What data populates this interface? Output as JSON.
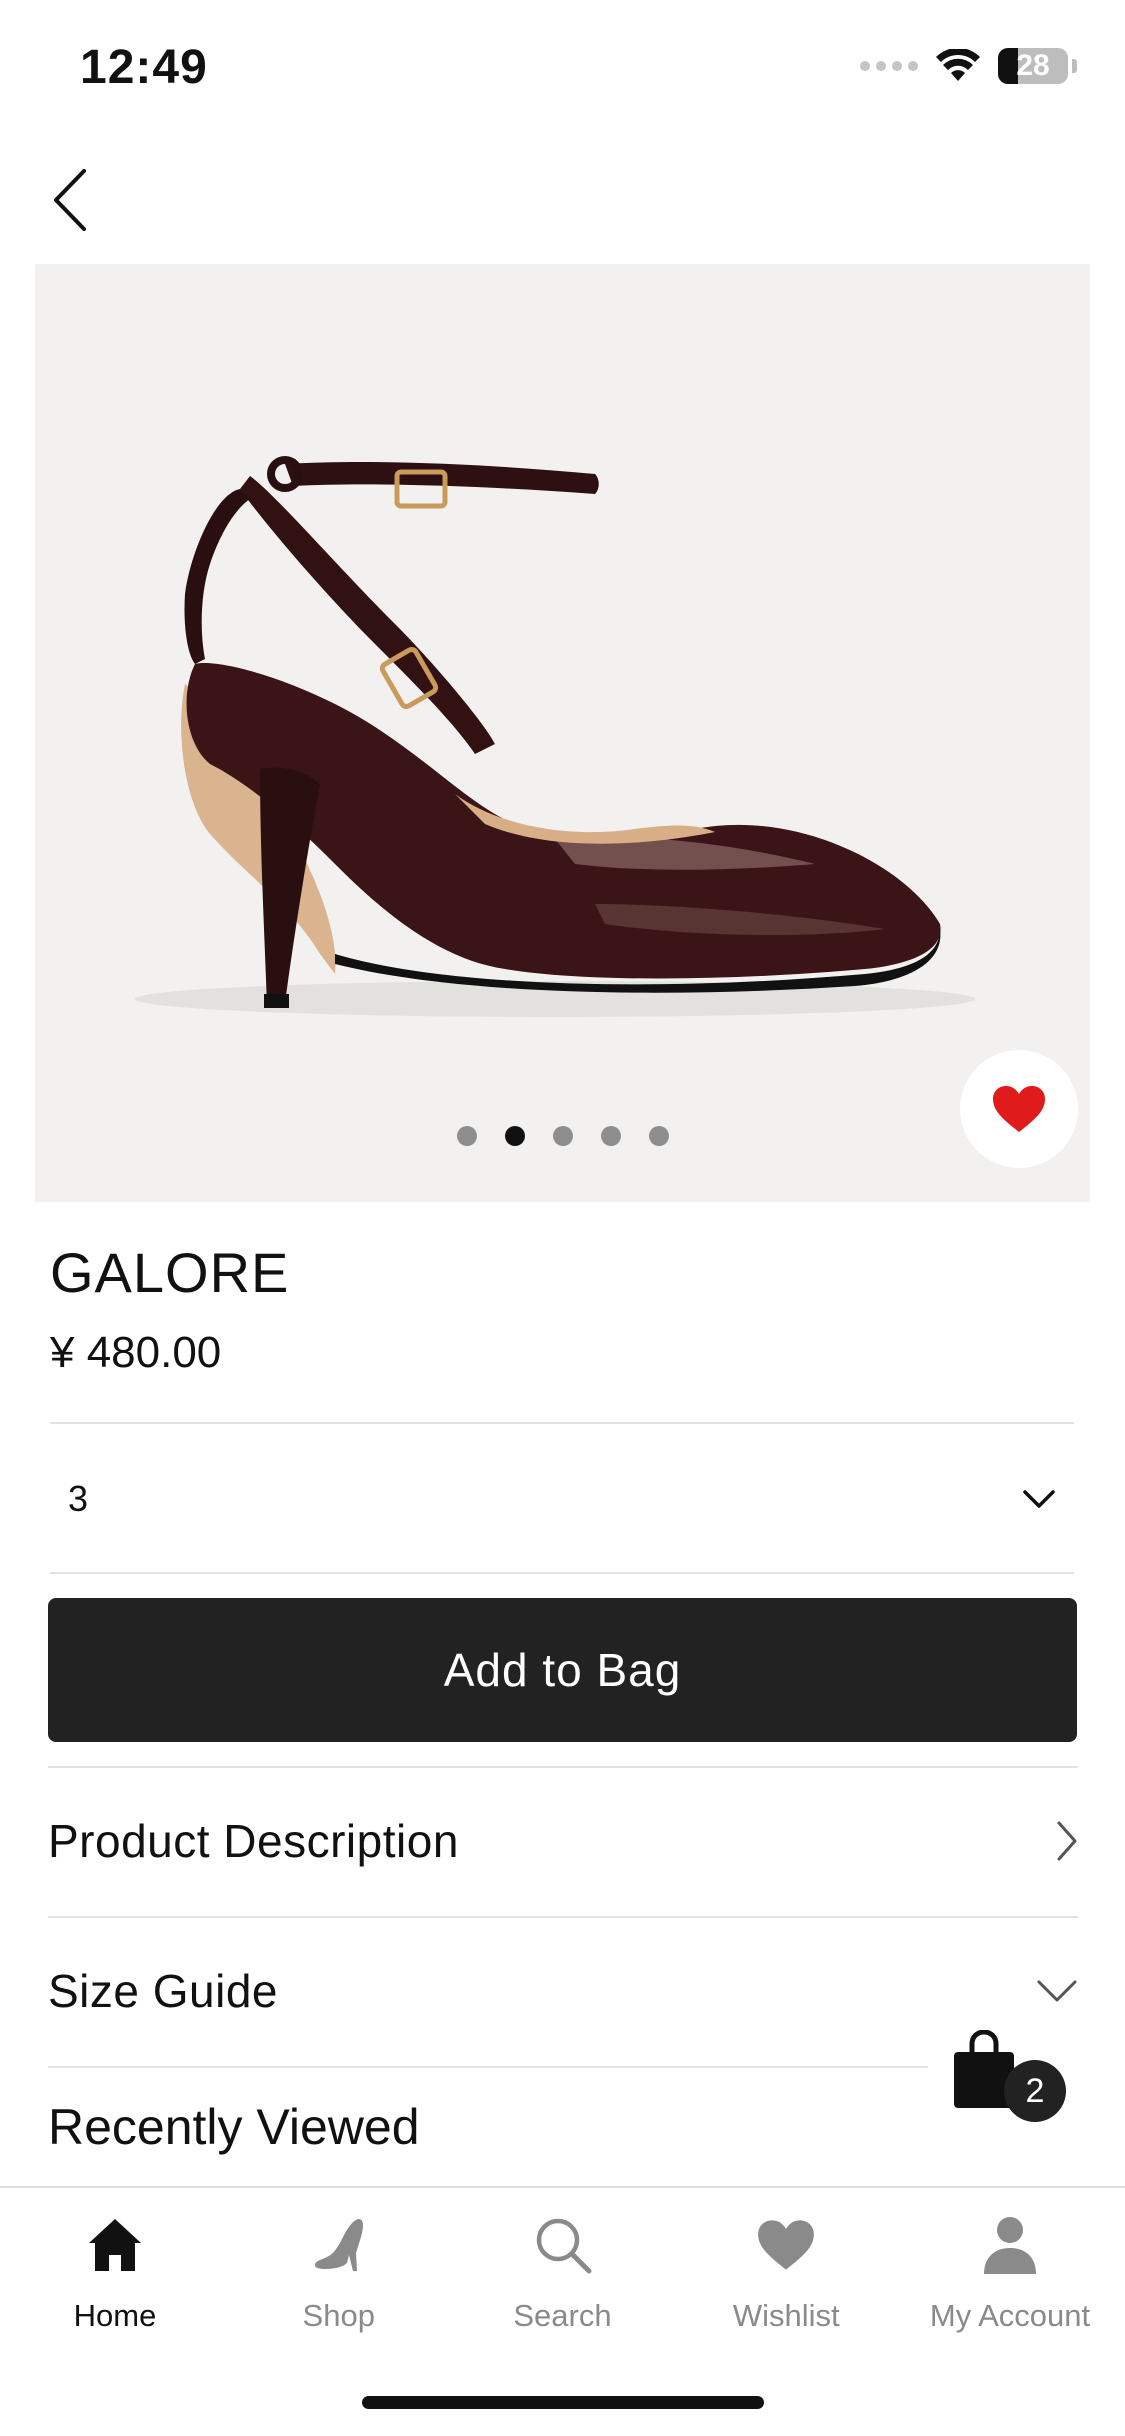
{
  "status_bar": {
    "time": "12:49",
    "battery": "28",
    "battery_level": 0.28
  },
  "product": {
    "name": "GALORE",
    "price": "¥ 480.00",
    "image_icon": "high-heel-shoe-image",
    "carousel": {
      "count": 5,
      "active_index": 1
    },
    "wishlisted": true
  },
  "size_select": {
    "value": "3",
    "icon": "chevron-down-icon"
  },
  "actions": {
    "add_to_bag_label": "Add to Bag"
  },
  "sections": {
    "product_description": "Product Description",
    "size_guide": "Size Guide",
    "recently_viewed": "Recently Viewed"
  },
  "floating_bag": {
    "count": "2"
  },
  "tab_bar": {
    "items": [
      {
        "label": "Home",
        "icon": "home-icon",
        "active": true
      },
      {
        "label": "Shop",
        "icon": "heel-icon",
        "active": false
      },
      {
        "label": "Search",
        "icon": "search-icon",
        "active": false
      },
      {
        "label": "Wishlist",
        "icon": "heart-icon",
        "active": false
      },
      {
        "label": "My Account",
        "icon": "user-icon",
        "active": false
      }
    ]
  },
  "colors": {
    "primary_button": "#222222",
    "wishlist_heart": "#e01b1b",
    "image_background": "#f2f1f0"
  }
}
